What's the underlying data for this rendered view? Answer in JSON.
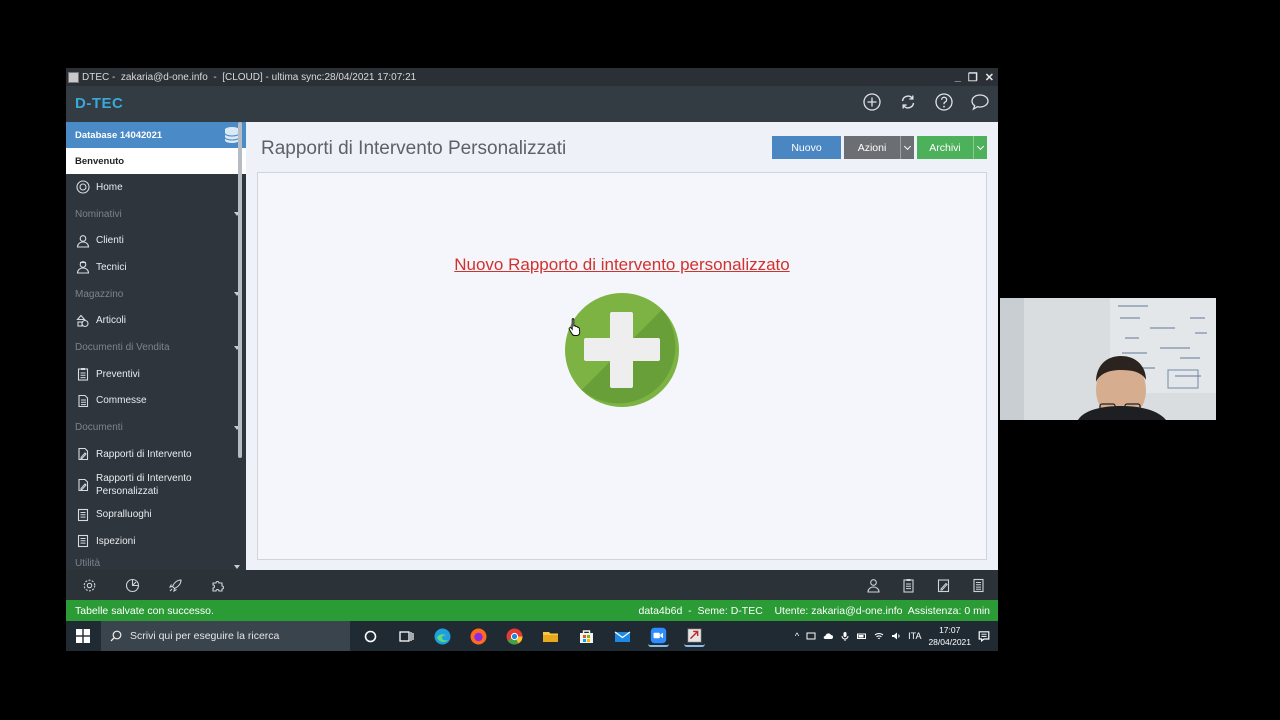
{
  "window": {
    "app_name": "DTEC",
    "title_text": " -  zakaria@d-one.info  -  [CLOUD] - ultima sync:28/04/2021 17:07:21",
    "controls": [
      "_",
      "❐",
      "✕"
    ]
  },
  "header": {
    "brand": "D-TEC",
    "icons": [
      "add-circle-icon",
      "sync-icon",
      "help-icon",
      "chat-icon"
    ]
  },
  "sidebar": {
    "database": "Database 14042021",
    "welcome": "Benvenuto",
    "home": "Home",
    "sections": {
      "nominativi": "Nominativi",
      "magazzino": "Magazzino",
      "documenti_vendita": "Documenti di Vendita",
      "documenti": "Documenti",
      "utilita": "Utilità"
    },
    "items": {
      "clienti": "Clienti",
      "tecnici": "Tecnici",
      "articoli": "Articoli",
      "preventivi": "Preventivi",
      "commesse": "Commesse",
      "rapporti": "Rapporti di Intervento",
      "rapporti_pers_1": "Rapporti di Intervento",
      "rapporti_pers_2": "Personalizzati",
      "sopralluoghi": "Sopralluoghi",
      "ispezioni": "Ispezioni"
    }
  },
  "main": {
    "title": "Rapporti di Intervento Personalizzati",
    "buttons": {
      "nuovo": "Nuovo",
      "azioni": "Azioni",
      "archivi": "Archivi"
    },
    "new_link": "Nuovo Rapporto di intervento personalizzato"
  },
  "statusbar": {
    "message": "Tabelle salvate con successo.",
    "right": "data4b6d  -  Seme: D-TEC    Utente: zakaria@d-one.info  Assistenza: 0 min"
  },
  "taskbar": {
    "search_placeholder": "Scrivi qui per eseguire la ricerca",
    "language": "ITA",
    "time": "17:07",
    "date": "28/04/2021"
  },
  "colors": {
    "accent_blue": "#4a86c2",
    "success_green": "#2a9b35",
    "link_red": "#d0322e",
    "plus_green": "#7cb342"
  }
}
